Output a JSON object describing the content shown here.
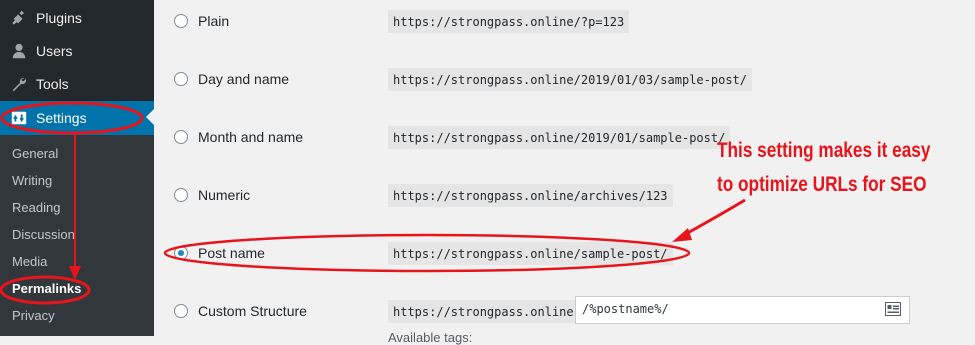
{
  "sidebar": {
    "items": [
      {
        "label": "Plugins",
        "icon": "plugin-icon"
      },
      {
        "label": "Users",
        "icon": "users-icon"
      },
      {
        "label": "Tools",
        "icon": "tools-icon"
      },
      {
        "label": "Settings",
        "icon": "settings-icon"
      }
    ],
    "submenu": [
      "General",
      "Writing",
      "Reading",
      "Discussion",
      "Media",
      "Permalinks",
      "Privacy"
    ]
  },
  "permalinks": {
    "options": [
      {
        "label": "Plain",
        "example": "https://strongpass.online/?p=123",
        "selected": false
      },
      {
        "label": "Day and name",
        "example": "https://strongpass.online/2019/01/03/sample-post/",
        "selected": false
      },
      {
        "label": "Month and name",
        "example": "https://strongpass.online/2019/01/sample-post/",
        "selected": false
      },
      {
        "label": "Numeric",
        "example": "https://strongpass.online/archives/123",
        "selected": false
      },
      {
        "label": "Post name",
        "example": "https://strongpass.online/sample-post/",
        "selected": true
      },
      {
        "label": "Custom Structure",
        "example": "https://strongpass.online",
        "selected": false
      }
    ],
    "custom_structure_value": "/%postname%/",
    "available_tags_label": "Available tags:"
  },
  "annotation": {
    "line1": "This setting makes it easy",
    "line2": "to optimize URLs for SEO",
    "color": "#e8141b"
  },
  "colors": {
    "sidebar_bg": "#23282d",
    "submenu_bg": "#32373c",
    "active_bg": "#0073aa",
    "content_bg": "#f1f1f1"
  }
}
